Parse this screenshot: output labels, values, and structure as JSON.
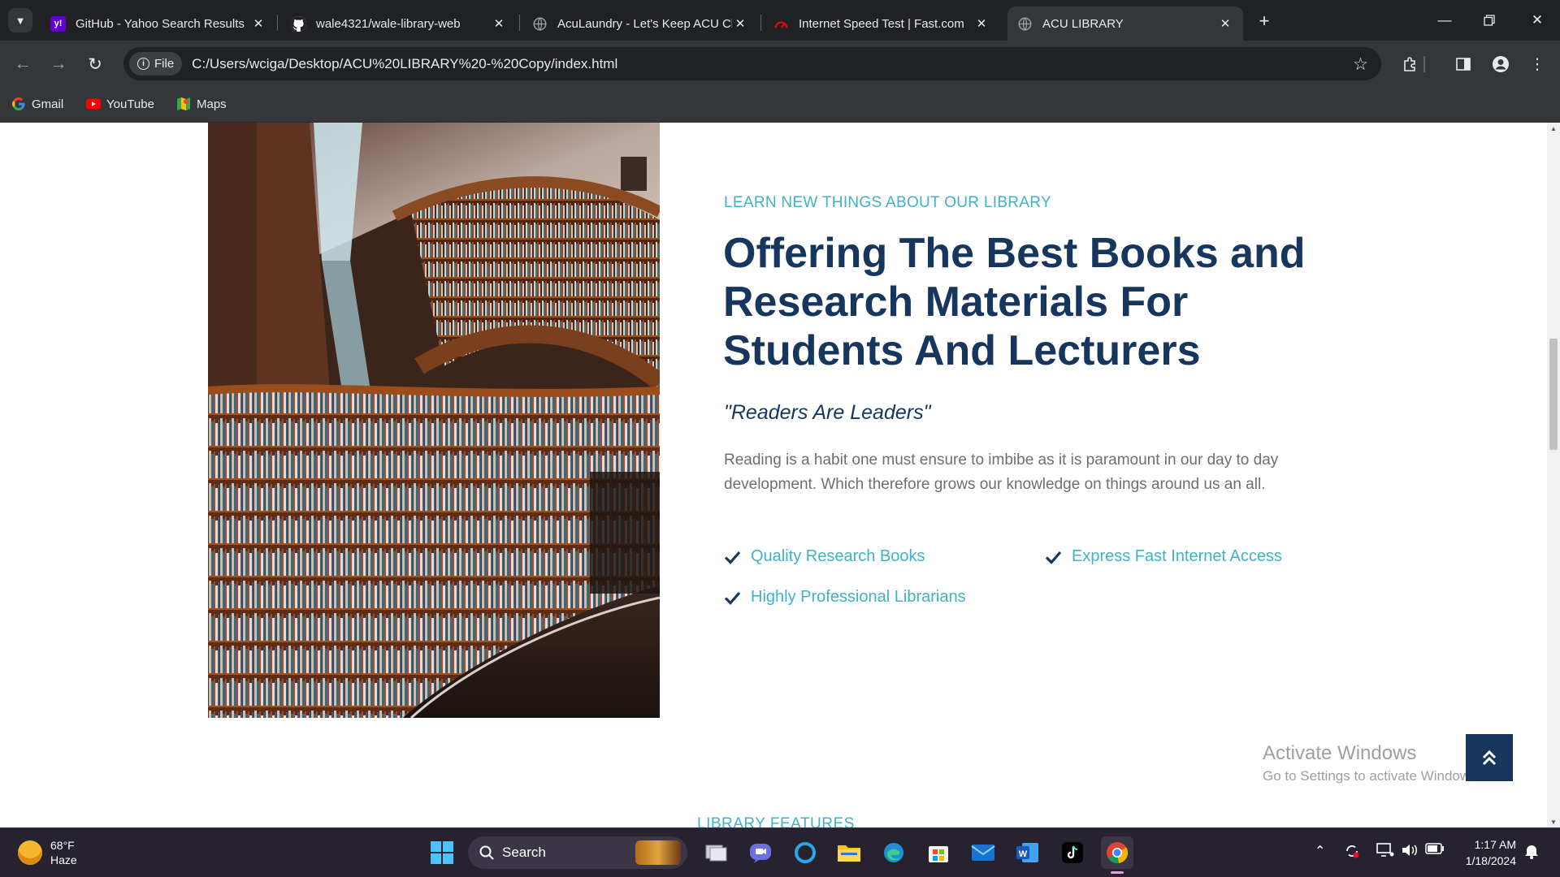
{
  "browser": {
    "tabs": [
      {
        "title": "GitHub - Yahoo Search Results",
        "icon": "yahoo-icon",
        "color": "#6001d2"
      },
      {
        "title": "wale4321/wale-library-web",
        "icon": "github-icon",
        "color": "#ffffff"
      },
      {
        "title": "AcuLaundry - Let's Keep ACU Cl",
        "icon": "globe-icon",
        "color": "#9aa0a6"
      },
      {
        "title": "Internet Speed Test | Fast.com",
        "icon": "fast-icon",
        "color": "#e50914"
      },
      {
        "title": "ACU LIBRARY",
        "icon": "globe-icon",
        "color": "#9aa0a6",
        "active": true
      }
    ],
    "address": {
      "scheme_chip": "File",
      "url": "C:/Users/wciga/Desktop/ACU%20LIBRARY%20-%20Copy/index.html"
    },
    "bookmarks": [
      {
        "label": "Gmail",
        "icon": "google-icon"
      },
      {
        "label": "YouTube",
        "icon": "youtube-icon"
      },
      {
        "label": "Maps",
        "icon": "maps-icon"
      }
    ]
  },
  "page": {
    "eyebrow": "LEARN NEW THINGS ABOUT OUR LIBRARY",
    "heading": "Offering The Best Books and Research Materials For Students And Lecturers",
    "quote": "\"Readers Are Leaders\"",
    "description": "Reading is a habit one must ensure to imbibe as it is paramount in our day to day development. Which therefore grows our knowledge on things around us an all.",
    "features": [
      "Quality Research Books",
      "Express Fast Internet Access",
      "Highly Professional Librarians"
    ],
    "next_section_label": "LIBRARY FEATURES",
    "accent_color": "#3fb2c7",
    "primary_color": "#17365e"
  },
  "overlay": {
    "activate_title": "Activate Windows",
    "activate_subtitle": "Go to Settings to activate Windows."
  },
  "taskbar": {
    "weather_temp": "68°F",
    "weather_desc": "Haze",
    "search_label": "Search",
    "time": "1:17 AM",
    "date": "1/18/2024"
  }
}
